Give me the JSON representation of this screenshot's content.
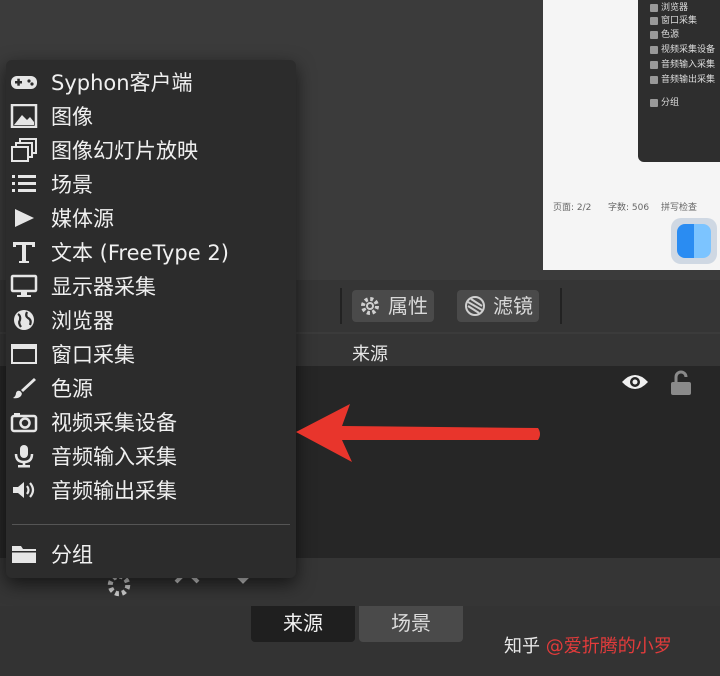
{
  "preview": {
    "window_items": [
      "浏览器",
      "窗口采集",
      "色源",
      "视频采集设备",
      "音频输入采集",
      "音频输出采集",
      "分组"
    ],
    "status_page": "页面: 2/2",
    "status_chars": "字数: 506",
    "status_spell": "拼写检查"
  },
  "toolbar": {
    "properties_label": "属性",
    "filters_label": "滤镜"
  },
  "list": {
    "column_header": "来源"
  },
  "tabs": {
    "sources": "来源",
    "scenes": "场景"
  },
  "watermark": {
    "left": "知乎",
    "right": "@爱折腾的小罗"
  },
  "menu": {
    "items": [
      {
        "label": "Syphon客户端",
        "icon": "gamepad-icon"
      },
      {
        "label": "图像",
        "icon": "image-icon"
      },
      {
        "label": "图像幻灯片放映",
        "icon": "slideshow-icon"
      },
      {
        "label": "场景",
        "icon": "list-icon"
      },
      {
        "label": "媒体源",
        "icon": "play-icon"
      },
      {
        "label": "文本 (FreeType 2)",
        "icon": "text-icon"
      },
      {
        "label": "显示器采集",
        "icon": "monitor-icon"
      },
      {
        "label": "浏览器",
        "icon": "globe-icon"
      },
      {
        "label": "窗口采集",
        "icon": "window-icon"
      },
      {
        "label": "色源",
        "icon": "brush-icon"
      },
      {
        "label": "视频采集设备",
        "icon": "camera-icon"
      },
      {
        "label": "音频输入采集",
        "icon": "microphone-icon"
      },
      {
        "label": "音频输出采集",
        "icon": "speaker-icon"
      }
    ],
    "group_label": "分组"
  },
  "colors": {
    "arrow": "#e8352c",
    "menu_bg": "#2c2c2c",
    "app_bg": "#3b3b3b"
  }
}
